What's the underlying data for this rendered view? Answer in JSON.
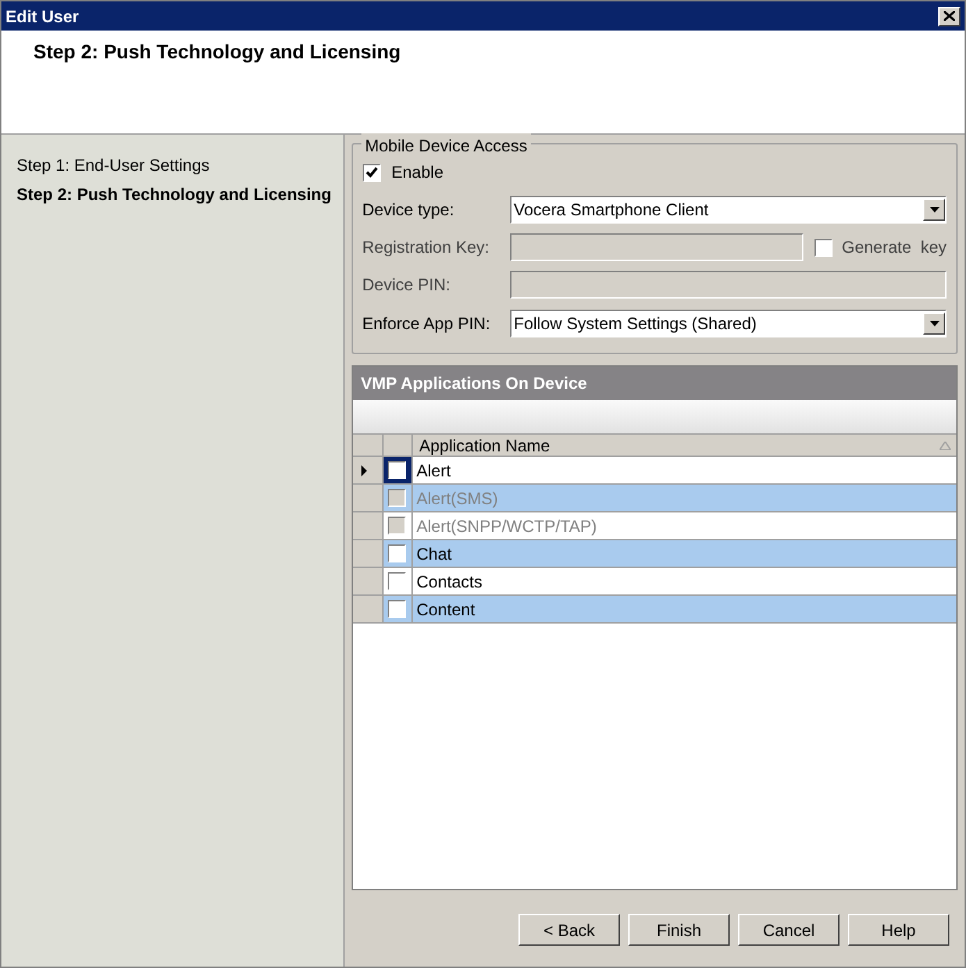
{
  "window": {
    "title": "Edit User"
  },
  "header": {
    "title": "Step 2: Push Technology and Licensing"
  },
  "steps": [
    {
      "label": "Step 1: End-User Settings",
      "selected": false
    },
    {
      "label": "Step 2: Push Technology and Licensing",
      "selected": true
    }
  ],
  "mobile_device_access": {
    "legend": "Mobile Device Access",
    "enable": {
      "label": "Enable",
      "checked": true
    },
    "device_type": {
      "label": "Device type:",
      "value": "Vocera Smartphone Client"
    },
    "registration_key": {
      "label": "Registration Key:",
      "generate_label": "Generate  key",
      "generate_checked": false
    },
    "device_pin": {
      "label": "Device PIN:"
    },
    "enforce_app_pin": {
      "label": "Enforce App PIN:",
      "value": "Follow System Settings (Shared)"
    }
  },
  "applications": {
    "title": "VMP Applications On Device",
    "column": "Application Name",
    "rows": [
      {
        "name": "Alert",
        "checked": false,
        "disabled": false,
        "current": true
      },
      {
        "name": "Alert(SMS)",
        "checked": false,
        "disabled": true,
        "current": false
      },
      {
        "name": "Alert(SNPP/WCTP/TAP)",
        "checked": false,
        "disabled": true,
        "current": false
      },
      {
        "name": "Chat",
        "checked": false,
        "disabled": false,
        "current": false
      },
      {
        "name": "Contacts",
        "checked": false,
        "disabled": false,
        "current": false
      },
      {
        "name": "Content",
        "checked": false,
        "disabled": false,
        "current": false
      }
    ]
  },
  "buttons": [
    "< Back",
    "Finish",
    "Cancel",
    "Help"
  ]
}
